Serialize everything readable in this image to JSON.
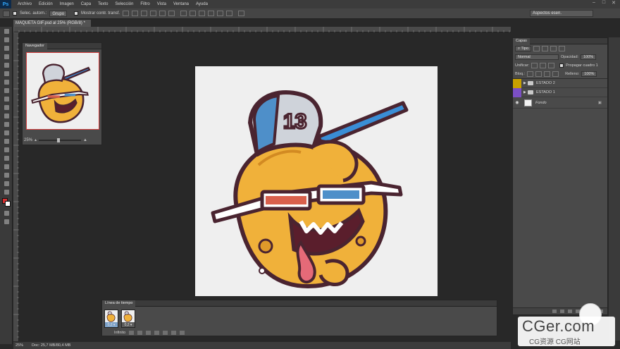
{
  "menubar": {
    "app_icon": "Ps",
    "items": [
      "Archivo",
      "Edición",
      "Imagen",
      "Capa",
      "Texto",
      "Selección",
      "Filtro",
      "Vista",
      "Ventana",
      "Ayuda"
    ],
    "window_controls": [
      "–",
      "□",
      "✕"
    ]
  },
  "options": {
    "auto_select_label": "Selec. autom.:",
    "auto_select_value": "Grupo",
    "transform_label": "Mostrar contr. transf.",
    "workspace": "Aspectos esen."
  },
  "document": {
    "tab_title": "MAQUETA GIF.psd al 25% (RGB/8) *",
    "tab_close": "×"
  },
  "navigator": {
    "title": "Navegador",
    "zoom": "25%"
  },
  "layers": {
    "title": "Capas",
    "filter_label": "Tipo",
    "blend_mode": "Normal",
    "opacity_label": "Opacidad:",
    "opacity_value": "100%",
    "unify_label": "Unificar:",
    "propagate_label": "Propagar cuadro 1",
    "lock_label": "Bloq.:",
    "fill_label": "Relleno:",
    "fill_value": "100%",
    "items": [
      {
        "name": "ESTADO 2",
        "color": "#c8a000",
        "type": "group"
      },
      {
        "name": "ESTADO 1",
        "color": "#7b4fc4",
        "type": "group"
      },
      {
        "name": "Fondo",
        "color": "",
        "type": "background"
      }
    ]
  },
  "timeline": {
    "title": "Línea de tiempo",
    "frames": [
      {
        "number": "1",
        "delay": "0,2 ▾"
      },
      {
        "number": "2",
        "delay": "0,2 ▾"
      }
    ],
    "loop": "Infinito"
  },
  "status": {
    "zoom": "25%",
    "doc": "Doc: 25,7 MB/80,4 MB"
  },
  "artwork": {
    "cap_number": "13"
  },
  "watermark": {
    "title": "CGer.com",
    "subtitle": "CG资源 CG网站"
  },
  "colors": {
    "accent_selection": "#7da2c9",
    "foreground_swatch": "#d83030",
    "background_swatch": "#ffffff"
  }
}
